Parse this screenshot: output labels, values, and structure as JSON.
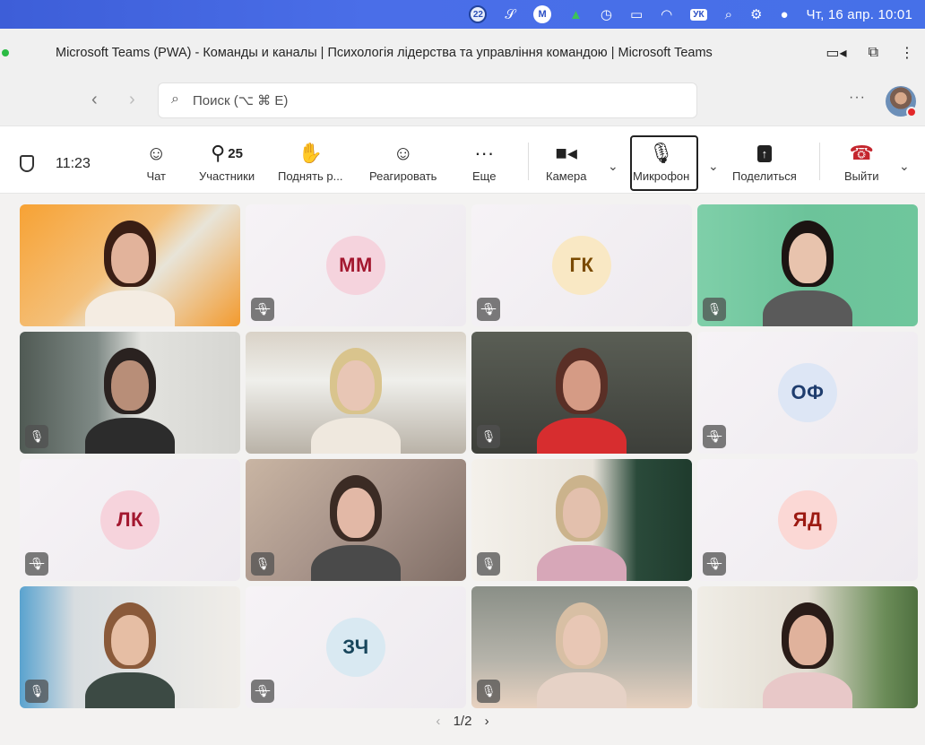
{
  "menubar": {
    "badge_count": "22",
    "m_label": "M",
    "lang": "УК",
    "datetime": "Чт, 16 апр.  10:01"
  },
  "window": {
    "title": "Microsoft Teams (PWA) - Команды и каналы | Психологія лідерства та управління командою | Microsoft Teams"
  },
  "search": {
    "placeholder": "Поиск (⌥ ⌘ E)"
  },
  "toolbar": {
    "elapsed": "11:23",
    "chat_label": "Чат",
    "participants_count": "25",
    "participants_label": "Участники",
    "raise_label": "Поднять р...",
    "react_label": "Реагировать",
    "more_label": "Еще",
    "camera_label": "Камера",
    "mic_label": "Микрофон",
    "share_label": "Поделиться",
    "leave_label": "Выйти"
  },
  "tiles": [
    {
      "type": "video",
      "muted": false
    },
    {
      "type": "initials",
      "initials": "ММ",
      "bg": "#f5d3dd",
      "fg": "#a3172f"
    },
    {
      "type": "initials",
      "initials": "ГК",
      "bg": "#f9e8c4",
      "fg": "#7a4a00"
    },
    {
      "type": "video",
      "muted": true
    },
    {
      "type": "video",
      "muted": true
    },
    {
      "type": "video",
      "muted": false
    },
    {
      "type": "video",
      "muted": true
    },
    {
      "type": "initials",
      "initials": "ОФ",
      "bg": "#dde6f5",
      "fg": "#1f3d6e"
    },
    {
      "type": "initials",
      "initials": "ЛК",
      "bg": "#f6d3dc",
      "fg": "#a3172f"
    },
    {
      "type": "video",
      "muted": true
    },
    {
      "type": "video",
      "muted": true
    },
    {
      "type": "initials",
      "initials": "ЯД",
      "bg": "#fbd8d5",
      "fg": "#9c1a12"
    },
    {
      "type": "video",
      "muted": true
    },
    {
      "type": "initials",
      "initials": "ЗЧ",
      "bg": "#d9e9f2",
      "fg": "#18465c"
    },
    {
      "type": "video",
      "muted": true
    },
    {
      "type": "video",
      "muted": false
    }
  ],
  "pager": {
    "label": "1/2"
  }
}
